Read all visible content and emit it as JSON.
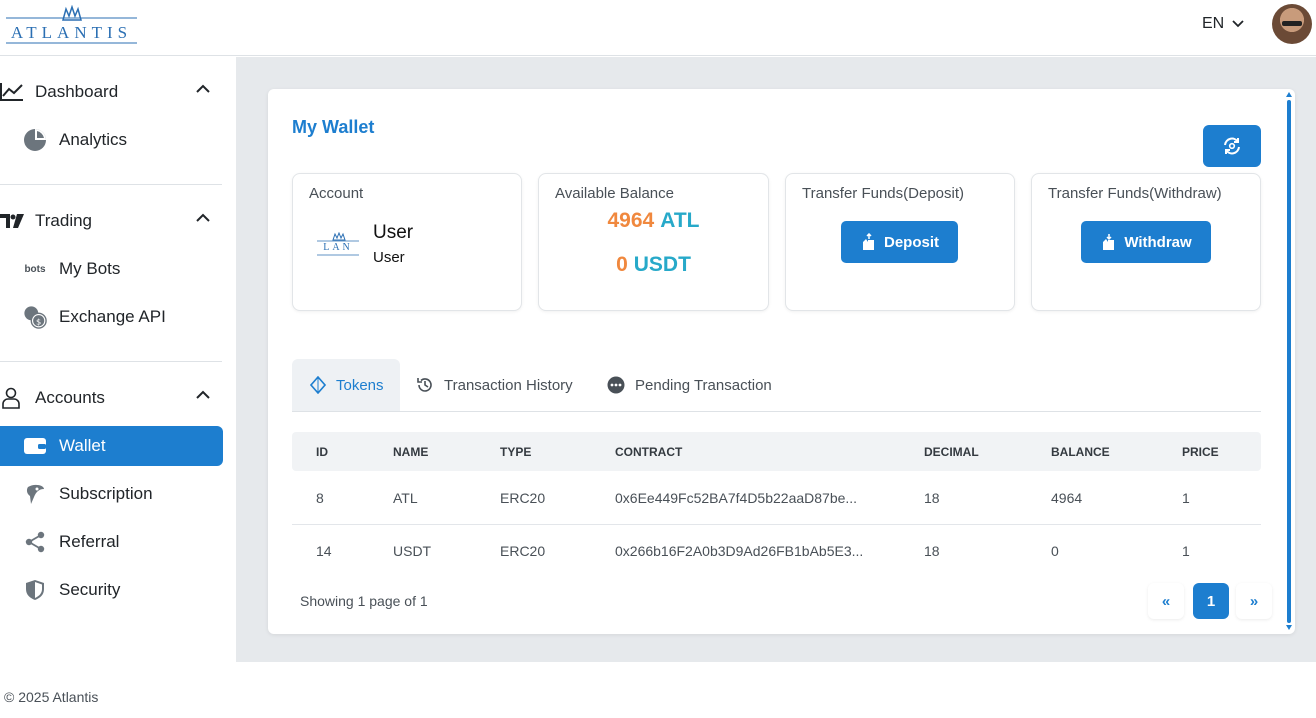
{
  "header": {
    "logo_text": "ATLANTIS",
    "language": "EN"
  },
  "sidebar": {
    "groups": [
      {
        "label": "Dashboard",
        "items": [
          {
            "label": "Analytics"
          }
        ]
      },
      {
        "label": "Trading",
        "items": [
          {
            "label": "My Bots",
            "icon_text": "bots"
          },
          {
            "label": "Exchange API"
          }
        ]
      },
      {
        "label": "Accounts",
        "items": [
          {
            "label": "Wallet"
          },
          {
            "label": "Subscription"
          },
          {
            "label": "Referral"
          },
          {
            "label": "Security"
          }
        ]
      }
    ],
    "active_item": "Wallet"
  },
  "wallet": {
    "title": "My Wallet",
    "account": {
      "title": "Account",
      "logo_text": "LAN",
      "name": "User",
      "role": "User"
    },
    "balance": {
      "title": "Available Balance",
      "rows": [
        {
          "value": "4964",
          "currency": "ATL"
        },
        {
          "value": "0",
          "currency": "USDT"
        }
      ]
    },
    "deposit": {
      "title": "Transfer Funds(Deposit)",
      "button": "Deposit"
    },
    "withdraw": {
      "title": "Transfer Funds(Withdraw)",
      "button": "Withdraw"
    }
  },
  "tabs": [
    {
      "label": "Tokens",
      "active": true
    },
    {
      "label": "Transaction History",
      "active": false
    },
    {
      "label": "Pending Transaction",
      "active": false
    }
  ],
  "table": {
    "columns": [
      "ID",
      "NAME",
      "TYPE",
      "CONTRACT",
      "DECIMAL",
      "BALANCE",
      "PRICE"
    ],
    "rows": [
      [
        "8",
        "ATL",
        "ERC20",
        "0x6Ee449Fc52BA7f4D5b22aaD87be...",
        "18",
        "4964",
        "1"
      ],
      [
        "14",
        "USDT",
        "ERC20",
        "0x266b16F2A0b3D9Ad26FB1bAb5E3...",
        "18",
        "0",
        "1"
      ]
    ]
  },
  "pagination": {
    "showing": "Showing 1 page of 1",
    "prev": "«",
    "current": "1",
    "next": "»"
  },
  "footer": {
    "text": "© 2025 Atlantis"
  },
  "colors": {
    "accent": "#1d7ecf",
    "balance_value": "#f0883e",
    "currency": "#27a9c9"
  }
}
